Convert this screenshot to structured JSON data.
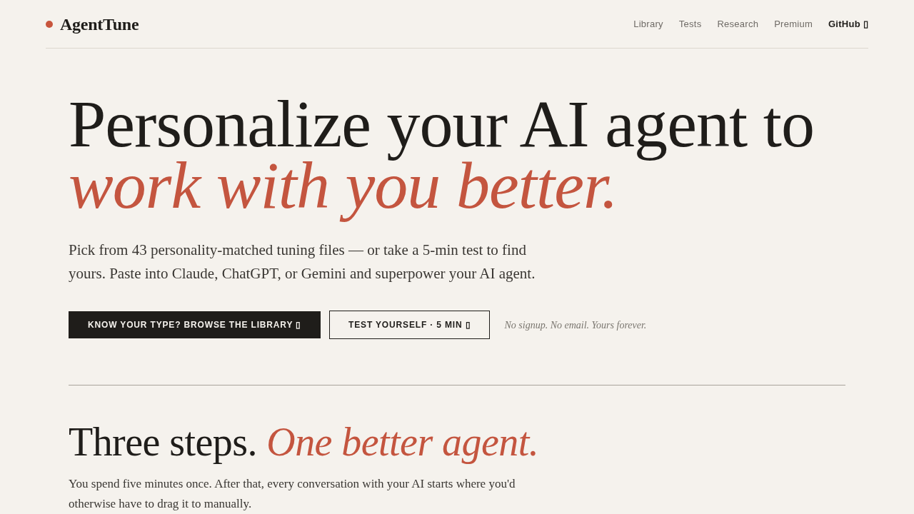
{
  "header": {
    "logo": "AgentTune",
    "nav": [
      {
        "label": "Library",
        "kind": "plain"
      },
      {
        "label": "Tests",
        "kind": "plain"
      },
      {
        "label": "Research",
        "kind": "plain"
      },
      {
        "label": "Premium",
        "kind": "plain"
      },
      {
        "label": "GitHub ▯",
        "kind": "strong"
      }
    ]
  },
  "hero": {
    "title": "Personalize your AI agent to *work with you better.*",
    "lead": "Pick from 43 personality-matched tuning files — or take a 5-min test to find yours. Paste into Claude, ChatGPT, or Gemini and superpower your AI agent.",
    "buttons": [
      {
        "label": "KNOW YOUR TYPE? BROWSE THE LIBRARY ▯",
        "kind": "primary"
      },
      {
        "label": "TEST YOURSELF · 5 MIN ▯",
        "kind": "secondary"
      }
    ],
    "note": "No signup. No email. Yours forever."
  },
  "steps": {
    "title": "Three steps. *One better agent.*",
    "text": "You spend five minutes once. After that, every conversation with your AI starts where you'd otherwise have to drag it to manually."
  }
}
